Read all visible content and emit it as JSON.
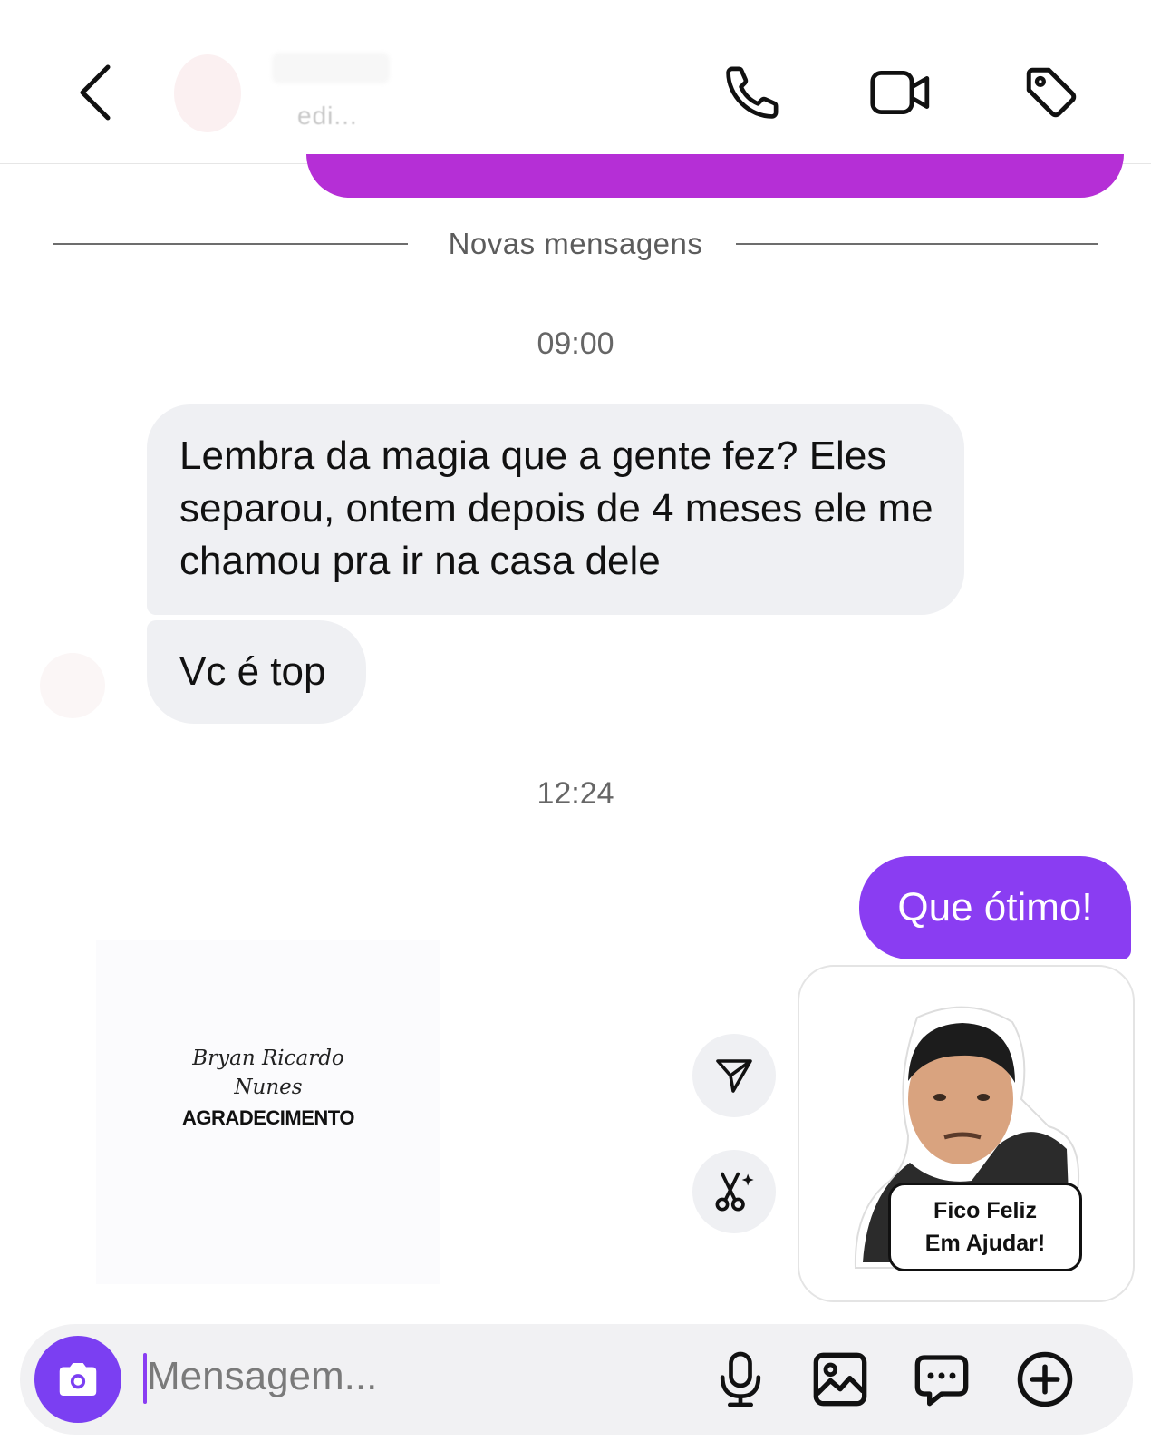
{
  "header": {
    "contact_status": "edi...",
    "icons": {
      "back": "chevron-left-icon",
      "call": "phone-icon",
      "video": "video-camera-icon",
      "tag": "tag-icon"
    }
  },
  "chat": {
    "divider_label": "Novas mensagens",
    "timestamp_1": "09:00",
    "incoming_1": "Lembra da magia que a gente fez? Eles separou, ontem depois de 4 meses ele me chamou pra ir na casa dele",
    "incoming_2": "Vc é top",
    "timestamp_2": "12:24",
    "outgoing_1": "Que ótimo!",
    "image_message": {
      "signature_line_1": "Bryan Ricardo",
      "signature_line_2": "Nunes",
      "caption": "AGRADECIMENTO"
    },
    "sticker": {
      "line_1": "Fico Feliz",
      "line_2": "Em Ajudar!"
    }
  },
  "composer": {
    "placeholder": "Mensagem...",
    "icons": {
      "camera": "camera-icon",
      "mic": "microphone-icon",
      "gallery": "image-icon",
      "chat": "chat-bubble-icon",
      "plus": "plus-circle-icon"
    }
  },
  "colors": {
    "accent": "#8a3df2",
    "previous_bubble": "#b52fd6",
    "incoming_bubble": "#eff0f3"
  }
}
